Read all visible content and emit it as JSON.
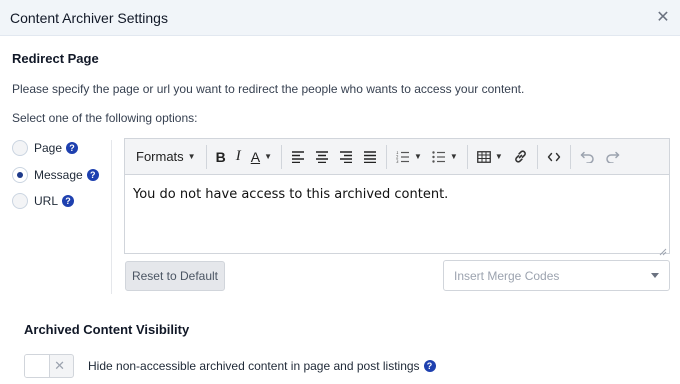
{
  "dialog": {
    "title": "Content Archiver Settings",
    "close_glyph": "✕"
  },
  "redirect": {
    "title": "Redirect Page",
    "description": "Please specify the page or url you want to redirect the people who wants to access your content.",
    "options_prompt": "Select one of the following options:",
    "options": [
      {
        "label": "Page",
        "selected": false
      },
      {
        "label": "Message",
        "selected": true
      },
      {
        "label": "URL",
        "selected": false
      }
    ]
  },
  "editor": {
    "formats_label": "Formats",
    "content": "You do not have access to this archived content."
  },
  "buttons": {
    "reset_label": "Reset to Default"
  },
  "merge_codes": {
    "placeholder": "Insert Merge Codes"
  },
  "visibility": {
    "title": "Archived Content Visibility",
    "toggle_label": "Hide non-accessible archived content in page and post listings",
    "toggle_on": false
  },
  "colors": {
    "accent": "#1e40af",
    "header_bg": "#f1f5f9"
  }
}
